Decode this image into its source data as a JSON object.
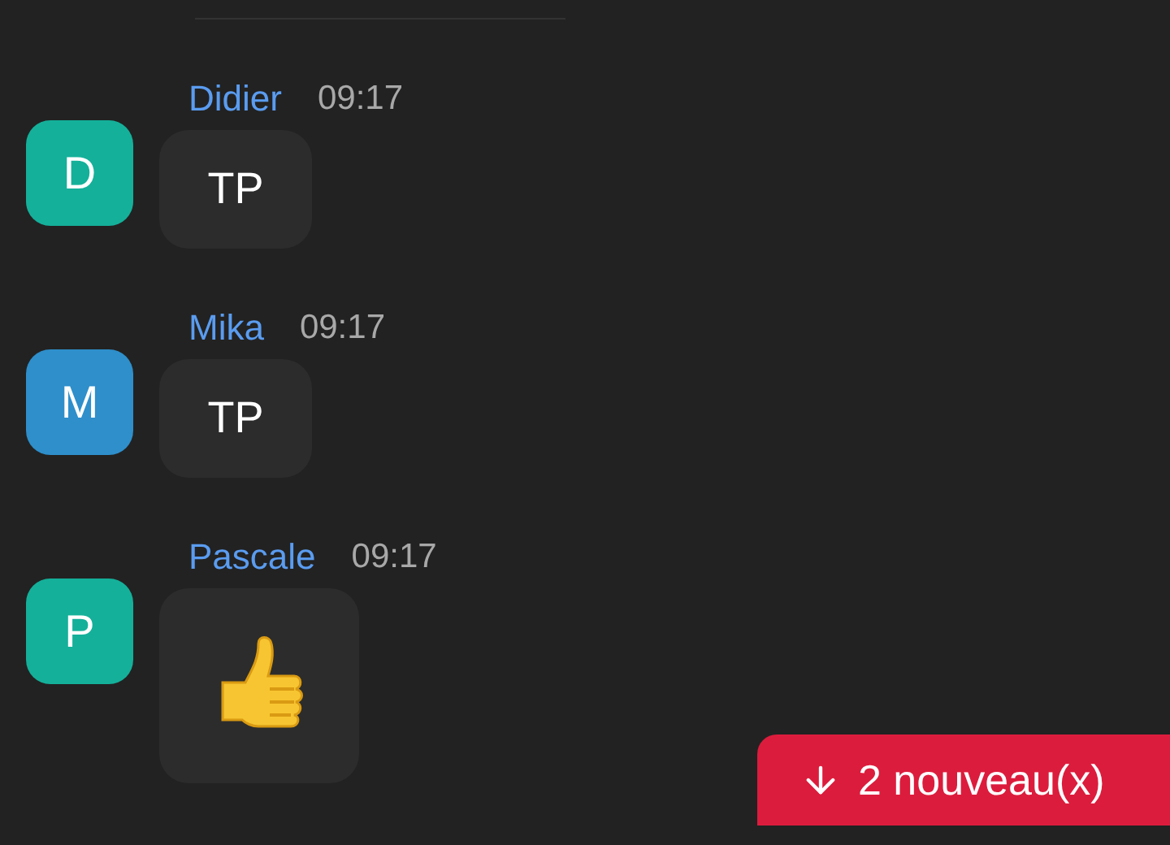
{
  "messages": [
    {
      "author": "Didier",
      "initial": "D",
      "color": "#14b09a",
      "time": "09:17",
      "kind": "text",
      "text": "TP"
    },
    {
      "author": "Mika",
      "initial": "M",
      "color": "#2e8fcb",
      "time": "09:17",
      "kind": "text",
      "text": "TP"
    },
    {
      "author": "Pascale",
      "initial": "P",
      "color": "#14b09a",
      "time": "09:17",
      "kind": "emoji"
    }
  ],
  "new_messages_button": {
    "label": "2 nouveau(x)"
  }
}
